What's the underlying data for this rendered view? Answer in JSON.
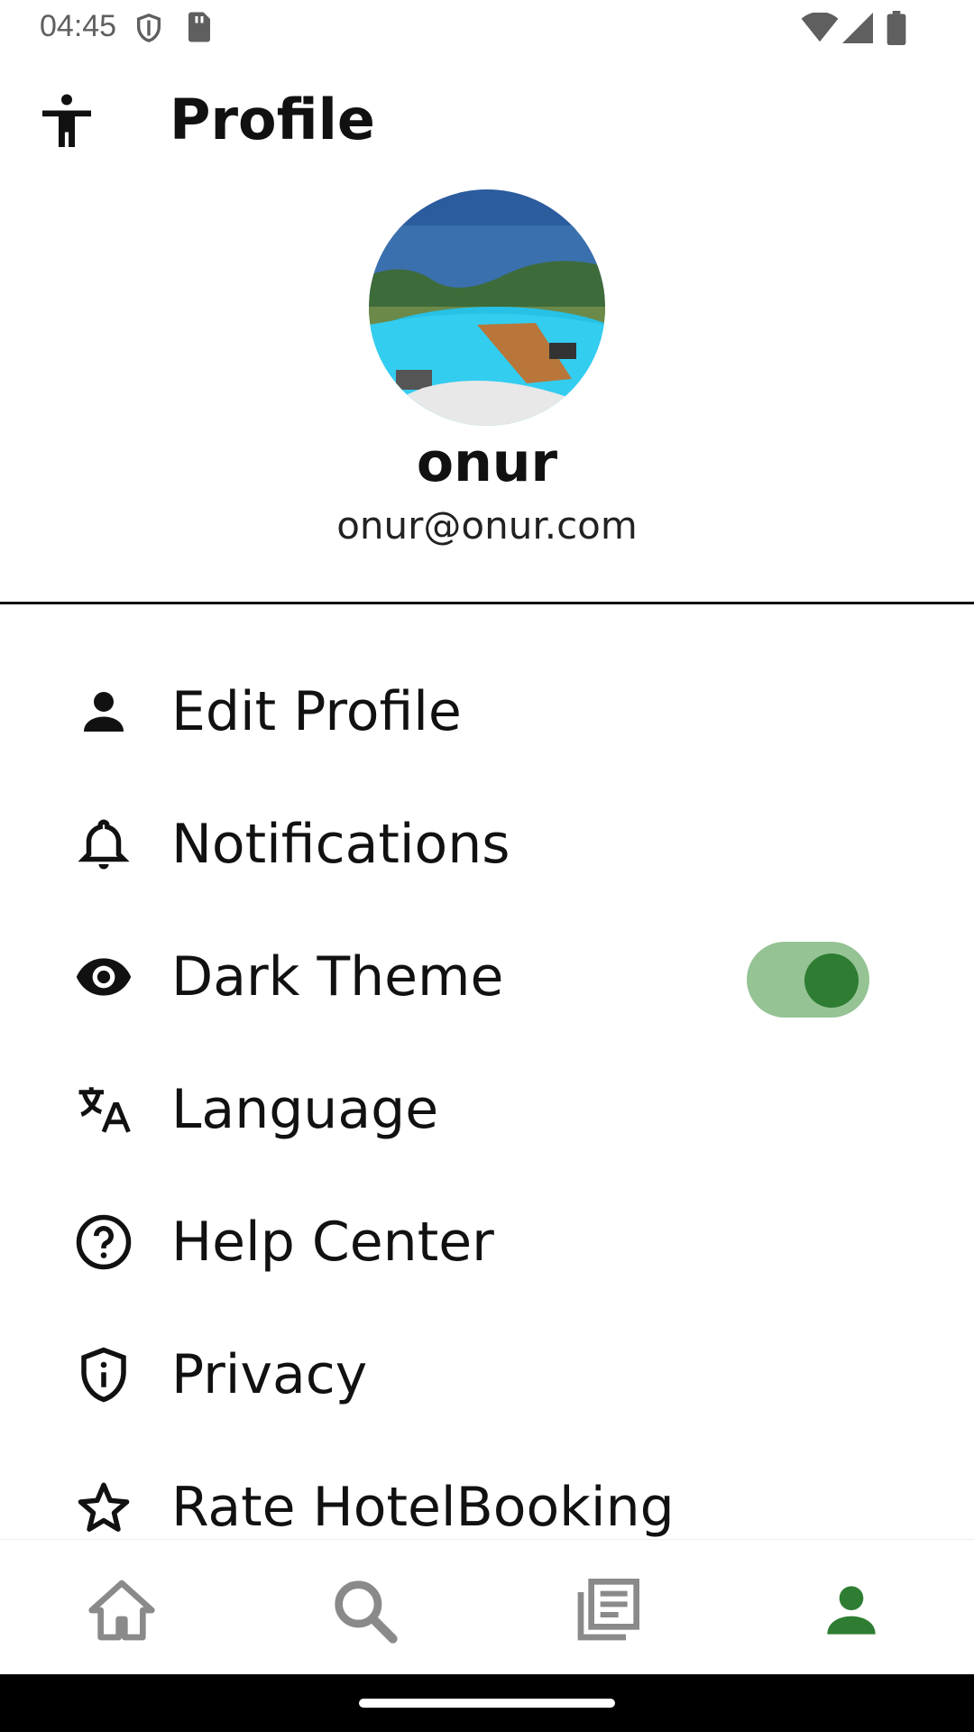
{
  "status_bar": {
    "time": "04:45",
    "icons": [
      "shield-icon",
      "sim-card-icon",
      "wifi-icon",
      "signal-icon",
      "battery-icon"
    ]
  },
  "app_bar": {
    "title": "Profile",
    "accessibility_icon": "accessibility-icon"
  },
  "profile": {
    "name": "onur",
    "email": "onur@onur.com"
  },
  "menu": {
    "items": [
      {
        "label": "Edit Profile",
        "icon": "person-icon"
      },
      {
        "label": "Notifications",
        "icon": "bell-icon"
      },
      {
        "label": "Dark Theme",
        "icon": "eye-icon",
        "toggle_on": true
      },
      {
        "label": "Language",
        "icon": "translate-icon"
      },
      {
        "label": "Help Center",
        "icon": "help-circle-icon"
      },
      {
        "label": "Privacy",
        "icon": "shield-info-icon"
      },
      {
        "label": "Rate HotelBooking",
        "icon": "star-outline-icon"
      }
    ]
  },
  "bottom_nav": {
    "items": [
      {
        "icon": "home-icon",
        "active": false
      },
      {
        "icon": "search-icon",
        "active": false
      },
      {
        "icon": "bookings-icon",
        "active": false
      },
      {
        "icon": "profile-icon",
        "active": true
      }
    ]
  },
  "colors": {
    "accent": "#2e7d32",
    "toggle_track": "#95c394",
    "inactive_nav": "#8a8a8a"
  }
}
